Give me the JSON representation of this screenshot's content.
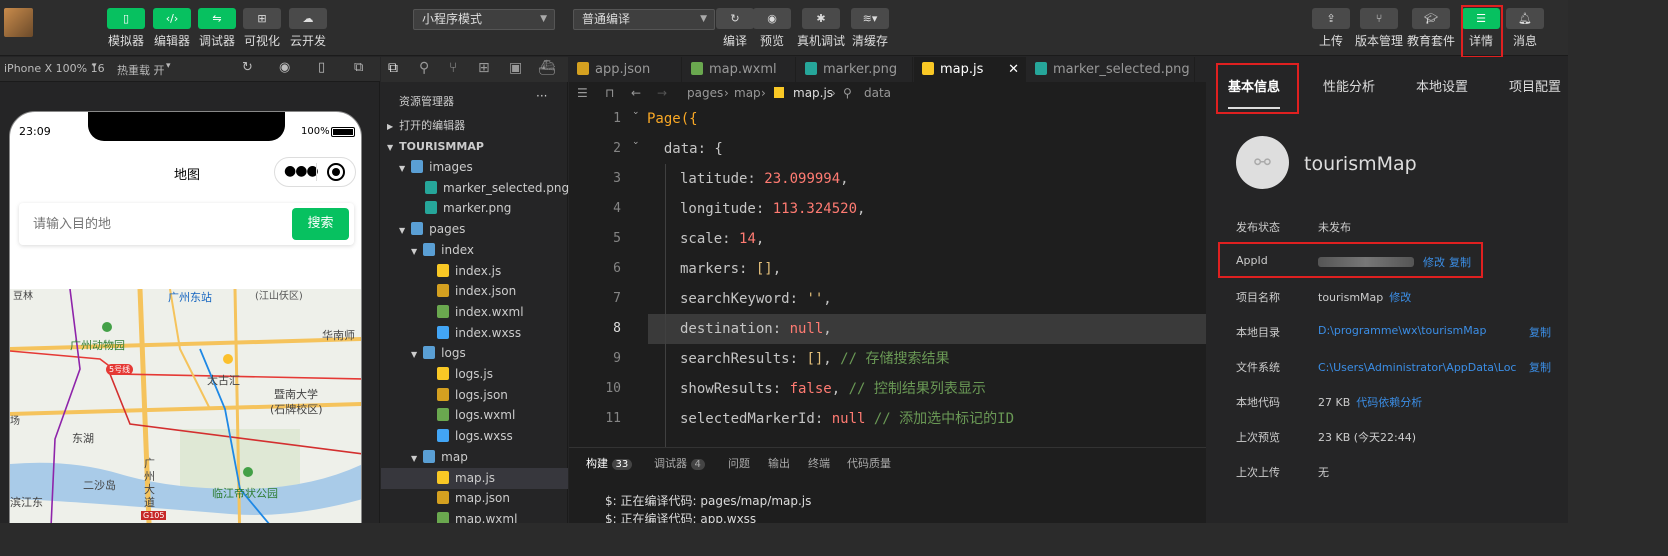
{
  "toolbar": {
    "left_buttons": [
      "模拟器",
      "编辑器",
      "调试器",
      "可视化",
      "云开发"
    ],
    "mode_select": "小程序模式",
    "compile_select": "普通编译",
    "mid_buttons": [
      "编译",
      "预览",
      "真机调试",
      "清缓存"
    ],
    "right_buttons": [
      "上传",
      "版本管理",
      "教育套件",
      "详情",
      "消息"
    ]
  },
  "simulator": {
    "device": "iPhone X 100% 16",
    "hot_reload": "热重载 开",
    "time": "23:09",
    "battery": "100%",
    "page_title": "地图",
    "search_placeholder": "请输入目的地",
    "search_button": "搜索",
    "map_labels": [
      "广州东站",
      "(江山仸区)",
      "华南师",
      "广州动物园",
      "5号线",
      "太古汇",
      "暨南大学",
      "(石牌校区)",
      "东湖",
      "广州大道",
      "二沙岛",
      "临江帝状公园",
      "滨江东",
      "G105",
      "场",
      "豆林"
    ]
  },
  "explorer": {
    "title": "资源管理器",
    "more": "···",
    "open_editors": "打开的编辑器",
    "project": "TOURISMMAP",
    "items": [
      {
        "label": "images",
        "type": "folder"
      },
      {
        "label": "marker_selected.png",
        "type": "png"
      },
      {
        "label": "marker.png",
        "type": "png"
      },
      {
        "label": "pages",
        "type": "folder"
      },
      {
        "label": "index",
        "type": "folder"
      },
      {
        "label": "index.js",
        "type": "js"
      },
      {
        "label": "index.json",
        "type": "json"
      },
      {
        "label": "index.wxml",
        "type": "wxml"
      },
      {
        "label": "index.wxss",
        "type": "wxss"
      },
      {
        "label": "logs",
        "type": "folder"
      },
      {
        "label": "logs.js",
        "type": "js"
      },
      {
        "label": "logs.json",
        "type": "json"
      },
      {
        "label": "logs.wxml",
        "type": "wxml"
      },
      {
        "label": "logs.wxss",
        "type": "wxss"
      },
      {
        "label": "map",
        "type": "folder"
      },
      {
        "label": "map.js",
        "type": "js"
      },
      {
        "label": "map.json",
        "type": "json"
      },
      {
        "label": "map.wxml",
        "type": "wxml"
      }
    ]
  },
  "editor": {
    "tabs": [
      "app.json",
      "map.wxml",
      "marker.png",
      "map.js",
      "marker_selected.png"
    ],
    "breadcrumb": [
      "pages",
      "map",
      "map.js",
      "data"
    ],
    "lines": [
      {
        "n": "1",
        "t": "Page({"
      },
      {
        "n": "2",
        "t": "  data: {"
      },
      {
        "n": "3",
        "k": "latitude: ",
        "v": "23.099994",
        "e": ","
      },
      {
        "n": "4",
        "k": "longitude: ",
        "v": "113.324520",
        "e": ","
      },
      {
        "n": "5",
        "k": "scale: ",
        "v": "14",
        "e": ","
      },
      {
        "n": "6",
        "k": "markers: ",
        "v": "[]",
        "e": ","
      },
      {
        "n": "7",
        "k": "searchKeyword: ",
        "v": "''",
        "e": ","
      },
      {
        "n": "8",
        "k": "destination: ",
        "v": "null",
        "e": ","
      },
      {
        "n": "9",
        "k": "searchResults: ",
        "v": "[]",
        "e": ", ",
        "c": "// 存储搜索结果"
      },
      {
        "n": "10",
        "k": "showResults: ",
        "v": "false",
        "e": ", ",
        "c": "// 控制结果列表显示"
      },
      {
        "n": "11",
        "k": "selectedMarkerId: ",
        "v": "null",
        "e": " ",
        "c": "// 添加选中标记的ID"
      }
    ]
  },
  "panel": {
    "tabs": [
      "构建",
      "调试器",
      "问题",
      "输出",
      "终端",
      "代码质量"
    ],
    "build_count": "33",
    "debug_count": "4",
    "output": [
      "$: 正在编译代码: pages/map/map.js",
      "$: 正在编译代码: app.wxss"
    ]
  },
  "details": {
    "tabs": [
      "基本信息",
      "性能分析",
      "本地设置",
      "项目配置"
    ],
    "project_name": "tourismMap",
    "rows": [
      {
        "label": "发布状态",
        "value": "未发布"
      },
      {
        "label": "AppId",
        "value": "",
        "action1": "修改",
        "action2": "复制"
      },
      {
        "label": "项目名称",
        "value": "tourismMap",
        "action1": "修改"
      },
      {
        "label": "本地目录",
        "value": "D:\\programme\\wx\\tourismMap",
        "action2": "复制"
      },
      {
        "label": "文件系统",
        "value": "C:\\Users\\Administrator\\AppData\\Local\\微信...",
        "action2": "复制"
      },
      {
        "label": "本地代码",
        "value": "27 KB",
        "action1": "代码依赖分析"
      },
      {
        "label": "上次预览",
        "value": "23 KB (今天22:44)"
      },
      {
        "label": "上次上传",
        "value": "无"
      }
    ]
  }
}
